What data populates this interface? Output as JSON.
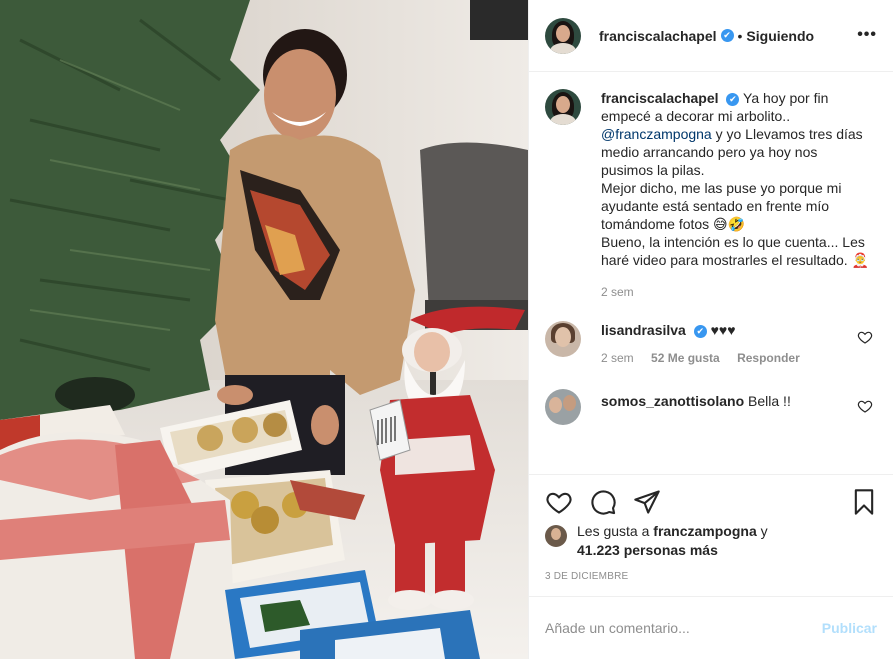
{
  "post": {
    "username": "franciscalachapel",
    "verified_glyph": "✔",
    "separator": "•",
    "follow_status": "Siguiendo",
    "more_glyph": "•••"
  },
  "caption": {
    "username": "franciscalachapel",
    "text_1": "Ya hoy por fin empecé a decorar mi arbolito..",
    "mention": "@franczampogna",
    "text_2": "y yo Llevamos tres días medio arrancando pero ya hoy nos pusimos la pilas.",
    "text_3": "Mejor dicho, me las puse yo porque mi ayudante está sentado en frente mío tomándome fotos 😅🤣",
    "text_4": "Bueno, la intención es lo que cuenta... Les haré video para mostrarles el resultado. 🤶",
    "time": "2 sem"
  },
  "comments": [
    {
      "username": "lisandrasilva",
      "text": "♥♥♥",
      "time": "2 sem",
      "likes": "52 Me gusta",
      "reply": "Responder"
    },
    {
      "username": "somos_zanottisolano",
      "text": "Bella !!"
    }
  ],
  "likes": {
    "prefix": "Les gusta a",
    "user": "franczampogna",
    "conj": "y",
    "count": "41.223 personas más"
  },
  "date": "3 DE DICIEMBRE",
  "add_comment": {
    "placeholder": "Añade un comentario...",
    "publish": "Publicar"
  },
  "colors": {
    "link": "#00376b",
    "verified": "#3897f0",
    "publish_disabled": "#b2dffc",
    "secondary_text": "#8e8e8e"
  }
}
